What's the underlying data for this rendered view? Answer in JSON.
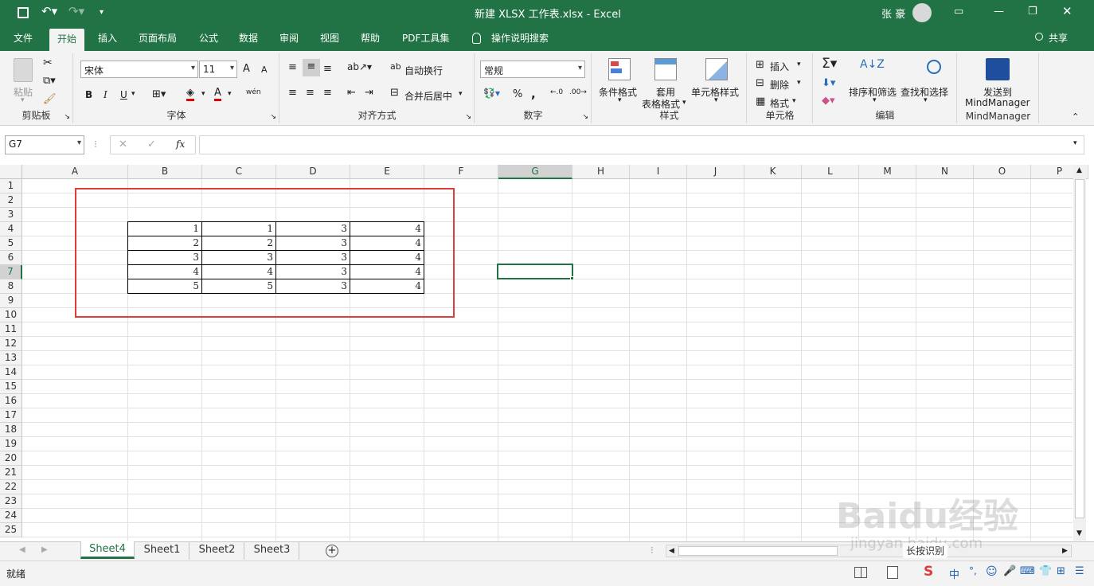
{
  "titlebar": {
    "title": "新建 XLSX 工作表.xlsx  -  Excel",
    "user": "张 豪"
  },
  "tabs": [
    "文件",
    "开始",
    "插入",
    "页面布局",
    "公式",
    "数据",
    "审阅",
    "视图",
    "帮助",
    "PDF工具集",
    "操作说明搜索"
  ],
  "share_label": "共享",
  "ribbon": {
    "clipboard": {
      "paste": "粘贴",
      "group": "剪贴板"
    },
    "font": {
      "name": "宋体",
      "size": "11",
      "group": "字体",
      "bold": "B",
      "italic": "I",
      "underline": "U",
      "grow": "A",
      "shrink": "A",
      "color_a": "A",
      "phonetic": "wén"
    },
    "align": {
      "wrap": "自动换行",
      "merge": "合并后居中",
      "group": "对齐方式"
    },
    "number": {
      "format": "常规",
      "percent": "%",
      "comma": ",",
      "group": "数字"
    },
    "styles": {
      "cond": "条件格式",
      "table1": "套用",
      "table2": "表格格式",
      "cellstyle": "单元格样式",
      "group": "样式"
    },
    "cells": {
      "insert": "插入",
      "delete": "删除",
      "format": "格式",
      "group": "单元格"
    },
    "edit": {
      "sort": "排序和筛选",
      "find": "查找和选择",
      "group": "编辑"
    },
    "mind": {
      "l1": "发送到",
      "l2": "MindManager",
      "group": "MindManager"
    }
  },
  "formula": {
    "namebox": "G7",
    "fx": "fx",
    "value": ""
  },
  "columns": [
    "A",
    "B",
    "C",
    "D",
    "E",
    "F",
    "G",
    "H",
    "I",
    "J",
    "K",
    "L",
    "M",
    "N",
    "O",
    "P"
  ],
  "rows": [
    "1",
    "2",
    "3",
    "4",
    "5",
    "6",
    "7",
    "8",
    "9",
    "10",
    "11",
    "12",
    "13",
    "14",
    "15",
    "16",
    "17",
    "18",
    "19",
    "20",
    "21",
    "22",
    "23",
    "24",
    "25"
  ],
  "table": [
    [
      "1",
      "1",
      "3",
      "4"
    ],
    [
      "2",
      "2",
      "3",
      "4"
    ],
    [
      "3",
      "3",
      "3",
      "4"
    ],
    [
      "4",
      "4",
      "3",
      "4"
    ],
    [
      "5",
      "5",
      "3",
      "4"
    ]
  ],
  "active_cell": "G7",
  "sheets": [
    "Sheet4",
    "Sheet1",
    "Sheet2",
    "Sheet3"
  ],
  "active_sheet": "Sheet4",
  "status": {
    "ready": "就绪",
    "ime": "中"
  },
  "watermark": {
    "text": "Baidu经验",
    "url": "jingyan.baidu.com",
    "tip": "长按识别"
  },
  "colors": {
    "excel_green": "#217346",
    "highlight_red": "#e03a3a"
  }
}
